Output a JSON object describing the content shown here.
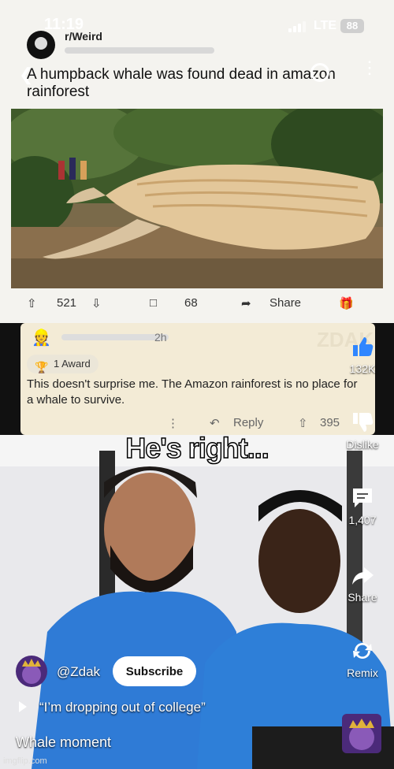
{
  "status_bar": {
    "time": "11:19",
    "network": "LTE",
    "battery": "88"
  },
  "post": {
    "subreddit": "r/Weird",
    "title": "A humpback whale was found dead in amazon rainforest",
    "upvotes": "521",
    "comments": "68",
    "share_label": "Share"
  },
  "comment": {
    "time": "2h",
    "award": "1 Award",
    "text": "This doesn't surprise me. The Amazon rainforest is no place for a whale to survive.",
    "reply_label": "Reply",
    "votes": "395",
    "watermark": "ZDAK"
  },
  "meme": {
    "caption": "He's right..."
  },
  "rail": {
    "like_count": "132K",
    "dislike_label": "Dislike",
    "comment_count": "1,407",
    "share_label": "Share",
    "remix_label": "Remix"
  },
  "channel": {
    "handle": "@Zdak",
    "subscribe_label": "Subscribe"
  },
  "sound": {
    "title": "“I’m dropping out of college”"
  },
  "description": "Whale moment",
  "credit": "imgflip.com",
  "icons": [
    "back-icon",
    "search-icon",
    "more-icon",
    "upvote-icon",
    "downvote-icon",
    "comment-icon",
    "share-icon",
    "award-icon",
    "like-icon",
    "dislike-icon",
    "comments-icon",
    "remix-icon",
    "play-icon"
  ]
}
